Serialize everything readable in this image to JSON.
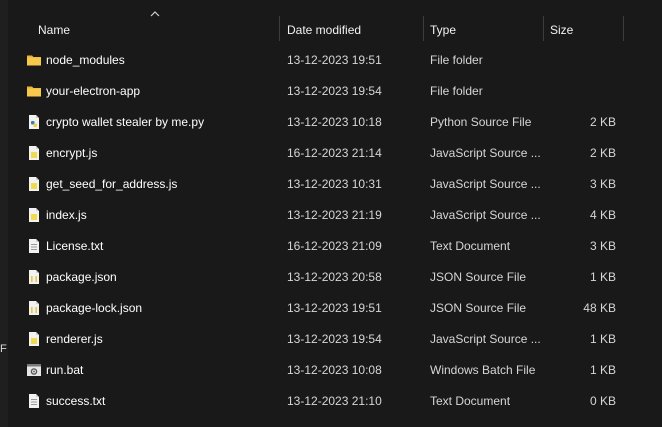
{
  "columns": {
    "name": "Name",
    "date": "Date modified",
    "type": "Type",
    "size": "Size"
  },
  "sort": {
    "column": "name",
    "direction": "ascending"
  },
  "left_edge_char": "F",
  "files": [
    {
      "name": "node_modules",
      "date": "13-12-2023 19:51",
      "type": "File folder",
      "size": "",
      "icon": "folder-icon"
    },
    {
      "name": "your-electron-app",
      "date": "13-12-2023 19:54",
      "type": "File folder",
      "size": "",
      "icon": "folder-icon"
    },
    {
      "name": "crypto wallet stealer by me.py",
      "date": "13-12-2023 10:18",
      "type": "Python Source File",
      "size": "2 KB",
      "icon": "python-file-icon"
    },
    {
      "name": "encrypt.js",
      "date": "16-12-2023 21:14",
      "type": "JavaScript Source ...",
      "size": "2 KB",
      "icon": "javascript-file-icon"
    },
    {
      "name": "get_seed_for_address.js",
      "date": "13-12-2023 10:31",
      "type": "JavaScript Source ...",
      "size": "3 KB",
      "icon": "javascript-file-icon"
    },
    {
      "name": "index.js",
      "date": "13-12-2023 21:19",
      "type": "JavaScript Source ...",
      "size": "4 KB",
      "icon": "javascript-file-icon"
    },
    {
      "name": "License.txt",
      "date": "16-12-2023 21:09",
      "type": "Text Document",
      "size": "3 KB",
      "icon": "text-file-icon"
    },
    {
      "name": "package.json",
      "date": "13-12-2023 20:58",
      "type": "JSON Source File",
      "size": "1 KB",
      "icon": "json-file-icon"
    },
    {
      "name": "package-lock.json",
      "date": "13-12-2023 19:51",
      "type": "JSON Source File",
      "size": "48 KB",
      "icon": "json-file-icon"
    },
    {
      "name": "renderer.js",
      "date": "13-12-2023 19:54",
      "type": "JavaScript Source ...",
      "size": "1 KB",
      "icon": "javascript-file-icon"
    },
    {
      "name": "run.bat",
      "date": "13-12-2023 10:08",
      "type": "Windows Batch File",
      "size": "1 KB",
      "icon": "batch-file-icon"
    },
    {
      "name": "success.txt",
      "date": "13-12-2023 21:10",
      "type": "Text Document",
      "size": "0 KB",
      "icon": "text-file-icon"
    }
  ],
  "colors": {
    "background": "#191919",
    "folder": "#f6c94c",
    "javascript": "#f0db4f",
    "json": "#e8c84a",
    "python": "#3f7cb5"
  }
}
